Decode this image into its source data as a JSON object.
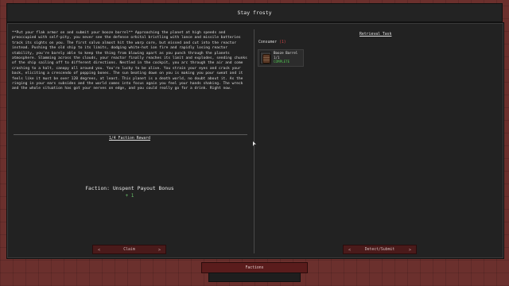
{
  "window": {
    "title": "Stay frosty"
  },
  "left": {
    "description": "**Put your flak armor on and submit your booze barrel** Approaching the planet at high speeds and preoccupied with self-pity, you never see the defense orbital bristling with lance and missile batteries track its sights on you. The first salvo almost hit the warp core, but missed and cut into the reactor instead. Pushing the old ship to its limits, dodging white-hot ion fire and rapidly losing reactor stability, you're barely able to keep the thing from blowing apart as you punch through the planets atmosphere. Slamming across the clouds, your reactor finally reaches its limit and explodes, sending chunks of the ship sailing off to different directions. Nestled in the cockpit, you arc through the air and come crashing to a halt, canopy all around you. You're lucky to be alive. You strain your eyes and crack your back, eliciting a crescendo of popping bones. The sun beating down on you is making you pour sweat and it feels like it must be over 120 degrees, at least. This planet is a death world, no doubt about it. As the ringing in your ears subsides and the world comes into focus again you feel your hands shaking. The wreck and the whole situation has got your nerves on edge, and you could really go for a drink. Right now.",
    "reward_title": "1/4 Faction Reward",
    "payout_label": "Faction: Unspent Payout Bonus",
    "payout_value": "+ 1",
    "claim_button": "Claim",
    "prev_arrow": "<",
    "next_arrow": ">"
  },
  "right": {
    "title": "Retrieval Task",
    "consumer_label": "Consumer",
    "consumer_count": "(1)",
    "item": {
      "icon": "booze-barrel-icon",
      "name": "Booze Barrel",
      "qty": "1/1",
      "status": "COMPLETE"
    },
    "submit_button": "Detect/Submit",
    "prev_arrow": "<",
    "next_arrow": ">"
  },
  "footer": {
    "button": "Factions"
  },
  "colors": {
    "background": "#6b302d",
    "panel": "#222222",
    "button": "#4a1a1a",
    "complete": "#4fc24f",
    "payout": "#6ac36a"
  }
}
